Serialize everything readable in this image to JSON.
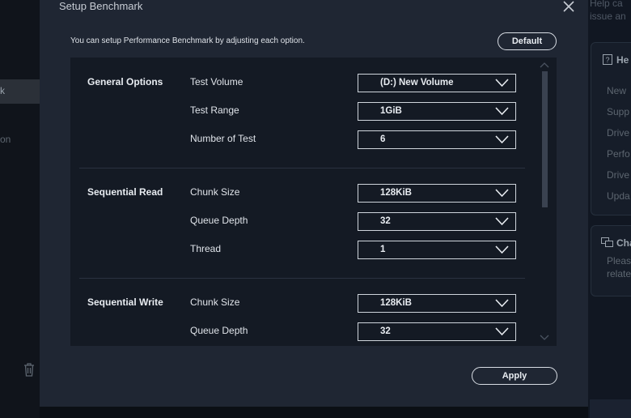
{
  "background": {
    "left_item_label": "k",
    "left_text": "on",
    "right_top_lines": [
      "Help ca",
      "issue an"
    ],
    "card1": {
      "title": "He",
      "lines": [
        "New",
        "Supp",
        "Drive",
        "Perfo",
        "Drive",
        "Upda"
      ]
    },
    "card2": {
      "title": "Cha",
      "lines": [
        "Pleas",
        "relate"
      ]
    }
  },
  "modal": {
    "title": "Setup Benchmark",
    "description": "You can setup Performance Benchmark by adjusting each option.",
    "default_label": "Default",
    "apply_label": "Apply"
  },
  "sections": {
    "general": {
      "label": "General Options",
      "rows": [
        {
          "label": "Test Volume",
          "value": "(D:) New Volume"
        },
        {
          "label": "Test Range",
          "value": "1GiB"
        },
        {
          "label": "Number of Test",
          "value": "6"
        }
      ]
    },
    "seq_read": {
      "label": "Sequential Read",
      "rows": [
        {
          "label": "Chunk Size",
          "value": "128KiB"
        },
        {
          "label": "Queue Depth",
          "value": "32"
        },
        {
          "label": "Thread",
          "value": "1"
        }
      ]
    },
    "seq_write": {
      "label": "Sequential Write",
      "rows": [
        {
          "label": "Chunk Size",
          "value": "128KiB"
        },
        {
          "label": "Queue Depth",
          "value": "32"
        }
      ]
    }
  },
  "colors": {
    "modal_bg": "#1f2633",
    "panel_bg": "#141a24",
    "text": "#e8ecf1",
    "border": "#cfd5dc"
  }
}
